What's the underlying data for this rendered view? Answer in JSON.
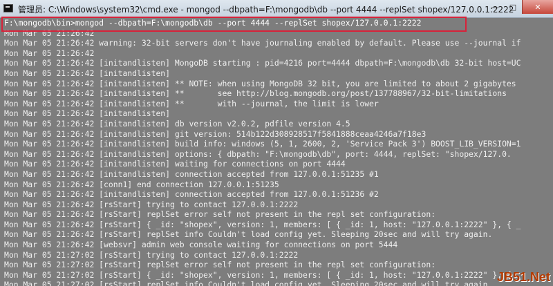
{
  "window": {
    "title": "管理员: C:\\Windows\\system32\\cmd.exe - mongod  --dbpath=F:\\mongodb\\db --port 4444 --replSet shopex/127.0.0.1:2222",
    "controls": {
      "minimize": "—",
      "maximize": "□",
      "close": "✕"
    }
  },
  "console": {
    "command_line": "F:\\mongodb\\bin>mongod --dbpath=F:\\mongodb\\db --port 4444 --replSet shopex/127.0.0.1:2222",
    "lines": [
      "Mon Mar 05 21:26:42",
      "Mon Mar 05 21:26:42 warning: 32-bit servers don't have journaling enabled by default. Please use --journal if",
      "Mon Mar 05 21:26:42",
      "Mon Mar 05 21:26:42 [initandlisten] MongoDB starting : pid=4216 port=4444 dbpath=F:\\mongodb\\db 32-bit host=UC",
      "Mon Mar 05 21:26:42 [initandlisten]",
      "Mon Mar 05 21:26:42 [initandlisten] ** NOTE: when using MongoDB 32 bit, you are limited to about 2 gigabytes",
      "Mon Mar 05 21:26:42 [initandlisten] **       see http://blog.mongodb.org/post/137788967/32-bit-limitations",
      "Mon Mar 05 21:26:42 [initandlisten] **       with --journal, the limit is lower",
      "Mon Mar 05 21:26:42 [initandlisten]",
      "Mon Mar 05 21:26:42 [initandlisten] db version v2.0.2, pdfile version 4.5",
      "Mon Mar 05 21:26:42 [initandlisten] git version: 514b122d308928517f5841888ceaa4246a7f18e3",
      "Mon Mar 05 21:26:42 [initandlisten] build info: windows (5, 1, 2600, 2, 'Service Pack 3') BOOST_LIB_VERSION=1",
      "Mon Mar 05 21:26:42 [initandlisten] options: { dbpath: \"F:\\mongodb\\db\", port: 4444, replSet: \"shopex/127.0.",
      "Mon Mar 05 21:26:42 [initandlisten] waiting for connections on port 4444",
      "Mon Mar 05 21:26:42 [initandlisten] connection accepted from 127.0.0.1:51235 #1",
      "Mon Mar 05 21:26:42 [conn1] end connection 127.0.0.1:51235",
      "Mon Mar 05 21:26:42 [initandlisten] connection accepted from 127.0.0.1:51236 #2",
      "Mon Mar 05 21:26:42 [rsStart] trying to contact 127.0.0.1:2222",
      "Mon Mar 05 21:26:42 [rsStart] replSet error self not present in the repl set configuration:",
      "Mon Mar 05 21:26:42 [rsStart] { _id: \"shopex\", version: 1, members: [ { _id: 1, host: \"127.0.0.1:2222\" }, { _",
      "Mon Mar 05 21:26:42 [rsStart] replSet info Couldn't load config yet. Sleeping 20sec and will try again.",
      "Mon Mar 05 21:26:42 [websvr] admin web console waiting for connections on port 5444",
      "Mon Mar 05 21:27:02 [rsStart] trying to contact 127.0.0.1:2222",
      "Mon Mar 05 21:27:02 [rsStart] replSet error self not present in the repl set configuration:",
      "Mon Mar 05 21:27:02 [rsStart] { _id: \"shopex\", version: 1, members: [ { _id: 1, host: \"127.0.0.1:2222\" }, { _",
      "Mon Mar 05 21:27:02 [rsStart] replSet info Couldn't load config yet. Sleeping 20sec and will try again."
    ]
  },
  "watermark": "JB51.Net",
  "colors": {
    "console_bg": "#7d7d7d",
    "console_text": "#efefef",
    "highlight_border": "#d8223a"
  }
}
